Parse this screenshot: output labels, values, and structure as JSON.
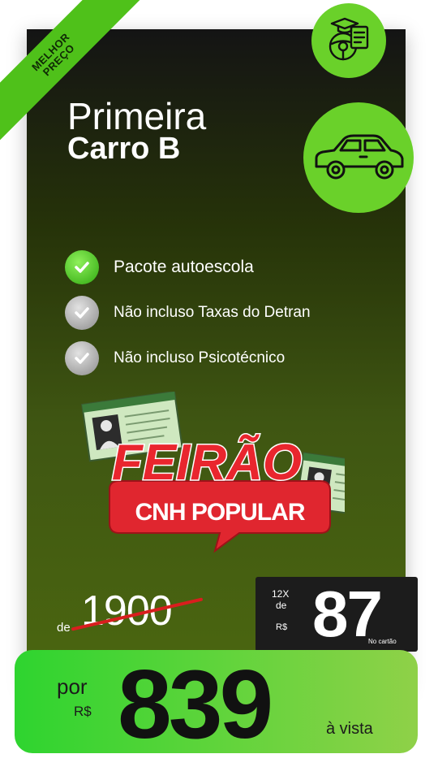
{
  "ribbon": {
    "line1": "MELHOR",
    "line2": "PREÇO"
  },
  "title": {
    "line1": "Primeira",
    "line2": "Carro B"
  },
  "features": [
    {
      "label": "Pacote autoescola",
      "icon": "check-green-icon"
    },
    {
      "label": "Não incluso Taxas do Detran",
      "icon": "check-gray-icon"
    },
    {
      "label": "Não incluso Psicotécnico",
      "icon": "check-gray-icon"
    }
  ],
  "promo": {
    "line1": "FEIRÃO",
    "line2": "CNH POPULAR"
  },
  "old_price": {
    "prefix": "de",
    "value": "1900"
  },
  "installment": {
    "count": "12X",
    "connector": "de",
    "currency": "R$",
    "value": "87",
    "note": "No cartão"
  },
  "cash_price": {
    "prefix": "por",
    "currency": "R$",
    "value": "839",
    "suffix": "à vista"
  },
  "colors": {
    "accent": "#6ad12a",
    "strike": "#d91e1e",
    "promo_red": "#e0262f"
  }
}
